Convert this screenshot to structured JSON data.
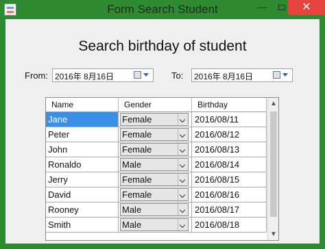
{
  "window": {
    "title": "Form Search Student",
    "controls": {
      "minimize": "—",
      "close": "✕"
    }
  },
  "heading": "Search birthday of student",
  "filters": {
    "from_label": "From:",
    "to_label": "To:",
    "from_date": "2016年  8月16日",
    "to_date": "2016年  8月16日"
  },
  "grid": {
    "columns": [
      "Name",
      "Gender",
      "Birthday"
    ],
    "rows": [
      {
        "name": "Jane",
        "gender": "Female",
        "birthday": "2016/08/11"
      },
      {
        "name": "Peter",
        "gender": "Female",
        "birthday": "2016/08/12"
      },
      {
        "name": "John",
        "gender": "Female",
        "birthday": "2016/08/13"
      },
      {
        "name": "Ronaldo",
        "gender": "Male",
        "birthday": "2016/08/14"
      },
      {
        "name": "Jerry",
        "gender": "Female",
        "birthday": "2016/08/15"
      },
      {
        "name": "David",
        "gender": "Female",
        "birthday": "2016/08/16"
      },
      {
        "name": "Rooney",
        "gender": "Male",
        "birthday": "2016/08/17"
      },
      {
        "name": "Smith",
        "gender": "Male",
        "birthday": "2016/08/18"
      }
    ],
    "selected_row": 0
  },
  "colors": {
    "frame": "#2f8b31",
    "selection": "#3a8fe6",
    "close_button": "#e6453f"
  },
  "icons": {
    "app": "form-app-icon",
    "calendar": "calendar-icon",
    "dropdown": "chevron-down-icon",
    "scroll_up": "arrow-up-icon",
    "scroll_down": "arrow-down-icon"
  }
}
